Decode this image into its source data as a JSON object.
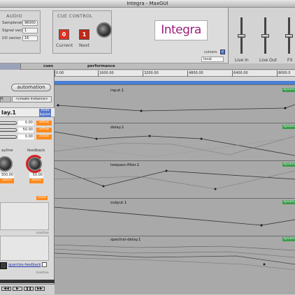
{
  "window": {
    "title": "Integra - MaxGUI"
  },
  "audio": {
    "title": "AUDIO",
    "rows": [
      {
        "label": "Samplerate",
        "value": "96000"
      },
      {
        "label": "Signal vector",
        "value": "1"
      },
      {
        "label": "I/O vector",
        "value": "16"
      }
    ]
  },
  "cue_control": {
    "title": "CUE CONTROL",
    "current_value": "0",
    "next_value": "1",
    "current_label": "Current",
    "next_label": "Next"
  },
  "logo": {
    "text": "Integra"
  },
  "cursors": {
    "label": "cursors",
    "select_value": "local"
  },
  "mixer": {
    "channels": [
      {
        "label": "Live In"
      },
      {
        "label": "Live Out"
      },
      {
        "label": "FX"
      }
    ]
  },
  "tabs": [
    {
      "label": "cues"
    },
    {
      "label": "performance"
    }
  ],
  "ruler": {
    "ticks": [
      "0.00",
      "1600.00",
      "3200.00",
      "4800.00",
      "6400.00",
      "8000.0"
    ]
  },
  "left_panel": {
    "automation_label": "automation",
    "create_instance_label": "<create instance>",
    "instance_name": "lay.1",
    "mute_label": "mute",
    "bypass_label": "bypass",
    "active_label": "active",
    "params": [
      {
        "value": "0.00"
      },
      {
        "value": "50.00"
      },
      {
        "value": "0.00"
      }
    ],
    "knob1": {
      "label": "ayline",
      "value": "300.00"
    },
    "knob2": {
      "label": "feedback",
      "value": "50.00"
    },
    "reset_label": "reset",
    "quantize_label": "quantize-feedback",
    "inactive_label": "inactive"
  },
  "lanes": [
    {
      "name": "input.1",
      "badge": "dynamic"
    },
    {
      "name": "delay.1",
      "badge": "dynamic"
    },
    {
      "name": "lowpass-filter.1",
      "badge": "dynamic"
    },
    {
      "name": "output.1",
      "badge": "dynamic"
    },
    {
      "name": "spectral-delay.1",
      "badge": "dynamic"
    }
  ],
  "colors": {
    "accent_blue": "#4a7fd6",
    "cue_red": "#e03020",
    "active_orange": "#ff8a1e",
    "logo_purple": "#9a1d7a"
  }
}
